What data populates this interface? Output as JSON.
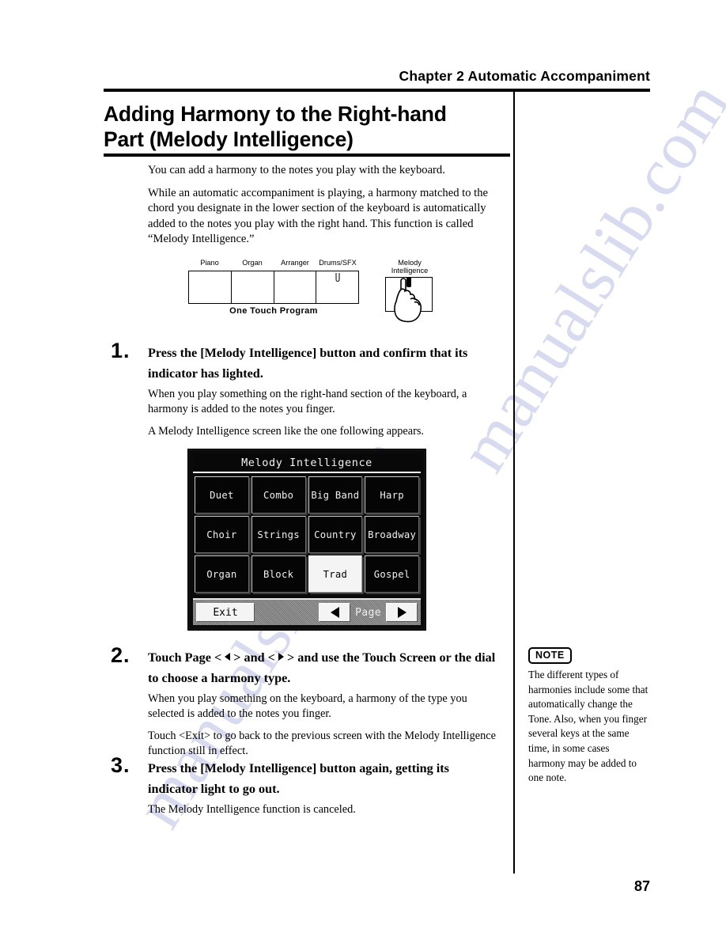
{
  "header": {
    "chapter": "Chapter 2 Automatic Accompaniment"
  },
  "title": {
    "line1": "Adding Harmony to the Right-hand",
    "line2": "Part (Melody Intelligence)"
  },
  "intro": {
    "p1": "You can add a harmony to the notes you play with the keyboard.",
    "p2": "While an automatic accompaniment is playing, a harmony matched to the chord you designate in the lower section of the keyboard is automatically added to the notes you play with the right hand. This function is called “Melody Intelligence.”"
  },
  "panel_diagram": {
    "one_touch_program": {
      "caption": "One Touch Program",
      "keys": [
        "Piano",
        "Organ",
        "Arranger",
        "Drums/SFX"
      ]
    },
    "melody_intelligence_button": {
      "label_line1": "Melody",
      "label_line2": "Intelligence"
    }
  },
  "steps": [
    {
      "number": "1.",
      "heading": "Press the [Melody Intelligence] button and confirm that its indicator has lighted.",
      "paragraphs": [
        "When you play something on the right-hand section of the keyboard, a harmony is added to the notes you finger.",
        "A Melody Intelligence screen like the one following appears."
      ]
    },
    {
      "number": "2.",
      "heading_pre": "Touch Page < ",
      "heading_mid": " > and < ",
      "heading_post": " > and use the Touch Screen or the dial to choose a harmony type.",
      "paragraphs": [
        "When you play something on the keyboard, a harmony of the type you selected is added to the notes you finger.",
        "Touch <Exit> to go back to the previous screen with the Melody Intelligence function still in effect."
      ]
    },
    {
      "number": "3.",
      "heading": "Press the [Melody Intelligence] button again, getting its indicator light to go out.",
      "paragraphs": [
        "The Melody Intelligence function is canceled."
      ]
    }
  ],
  "lcd": {
    "title": "Melody Intelligence",
    "harmony_types": [
      {
        "label": "Duet",
        "selected": false
      },
      {
        "label": "Combo",
        "selected": false
      },
      {
        "label": "Big Band",
        "selected": false
      },
      {
        "label": "Harp",
        "selected": false
      },
      {
        "label": "Choir",
        "selected": false
      },
      {
        "label": "Strings",
        "selected": false
      },
      {
        "label": "Country",
        "selected": false
      },
      {
        "label": "Broadway",
        "selected": false
      },
      {
        "label": "Organ",
        "selected": false
      },
      {
        "label": "Block",
        "selected": false
      },
      {
        "label": "Trad",
        "selected": true
      },
      {
        "label": "Gospel",
        "selected": false
      }
    ],
    "exit_label": "Exit",
    "page_label": "Page"
  },
  "note": {
    "badge": "NOTE",
    "text": "The different types of harmonies include some that automatically change the Tone. Also, when you finger several keys at the same time, in some cases harmony may be added to one note."
  },
  "footer": {
    "page_number": "87"
  },
  "watermark": {
    "text": "manualslib.com"
  }
}
